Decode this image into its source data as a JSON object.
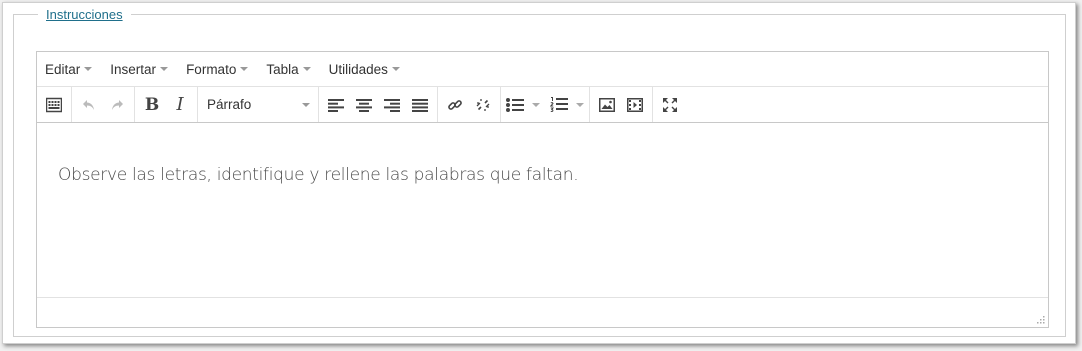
{
  "fieldset": {
    "legend": "Instrucciones"
  },
  "menubar": {
    "items": [
      {
        "label": "Editar"
      },
      {
        "label": "Insertar"
      },
      {
        "label": "Formato"
      },
      {
        "label": "Tabla"
      },
      {
        "label": "Utilidades"
      }
    ]
  },
  "toolbar": {
    "format_select": "Párrafo",
    "icons": [
      "keyboard-icon",
      "undo-icon",
      "redo-icon",
      "bold-icon",
      "italic-icon",
      "align-left-icon",
      "align-center-icon",
      "align-right-icon",
      "align-justify-icon",
      "link-icon",
      "unlink-icon",
      "bullet-list-icon",
      "numbered-list-icon",
      "image-icon",
      "media-icon",
      "fullscreen-icon"
    ]
  },
  "content": {
    "text": "Observe las letras, identifique y rellene las palabras que faltan."
  },
  "colors": {
    "legend": "#1f6f8b",
    "border": "#c8c8c8",
    "icon": "#444444"
  }
}
